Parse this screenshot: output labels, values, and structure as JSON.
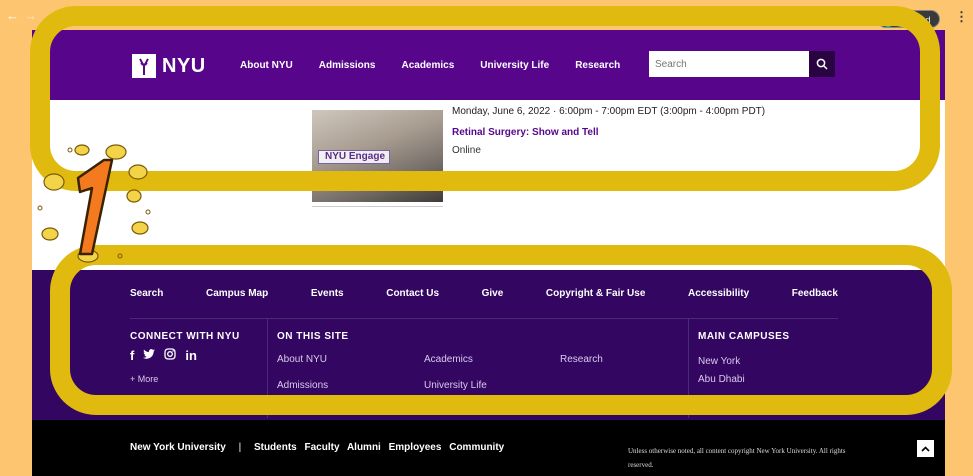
{
  "browser": {
    "paused_label": "Paused",
    "back_icon": "back-arrow-icon",
    "forward_icon": "forward-arrow-icon",
    "menu_icon": "kebab-menu-icon"
  },
  "header": {
    "logo_text": "NYU",
    "nav": [
      "About NYU",
      "Admissions",
      "Academics",
      "University Life",
      "Research"
    ],
    "search_placeholder": "Search",
    "search_icon": "search-icon"
  },
  "event": {
    "date": "Monday, June 6, 2022 · 6:00pm - 7:00pm EDT (3:00pm - 4:00pm PDT)",
    "title": "Retinal Surgery: Show and Tell",
    "location": "Online",
    "image_badge": "NYU Engage"
  },
  "footer": {
    "links": [
      "Search",
      "Campus Map",
      "Events",
      "Contact Us",
      "Give",
      "Copyright & Fair Use",
      "Accessibility",
      "Feedback"
    ],
    "connect_heading": "CONNECT WITH NYU",
    "social_icons": [
      "facebook-icon",
      "twitter-icon",
      "instagram-icon",
      "linkedin-icon"
    ],
    "more_label": "+ More",
    "site_heading": "ON THIS SITE",
    "site_links": [
      "About NYU",
      "Academics",
      "Research",
      "Admissions",
      "University Life"
    ],
    "campuses_heading": "MAIN CAMPUSES",
    "campuses": [
      "New York",
      "Abu Dhabi"
    ]
  },
  "bottom": {
    "university": "New York University",
    "separator": "|",
    "audience_links": [
      "Students",
      "Faculty",
      "Alumni",
      "Employees",
      "Community"
    ],
    "copyright": "Unless otherwise noted, all content copyright New York University. All rights reserved.",
    "top_icon": "chevron-up-icon"
  },
  "annotation": {
    "number": "1",
    "highlight_color": "#e0ba0f",
    "number_color": "#f47a1f"
  },
  "colors": {
    "nyu_purple": "#57068c",
    "footer_purple": "#330662",
    "background": "#fdc56f"
  }
}
